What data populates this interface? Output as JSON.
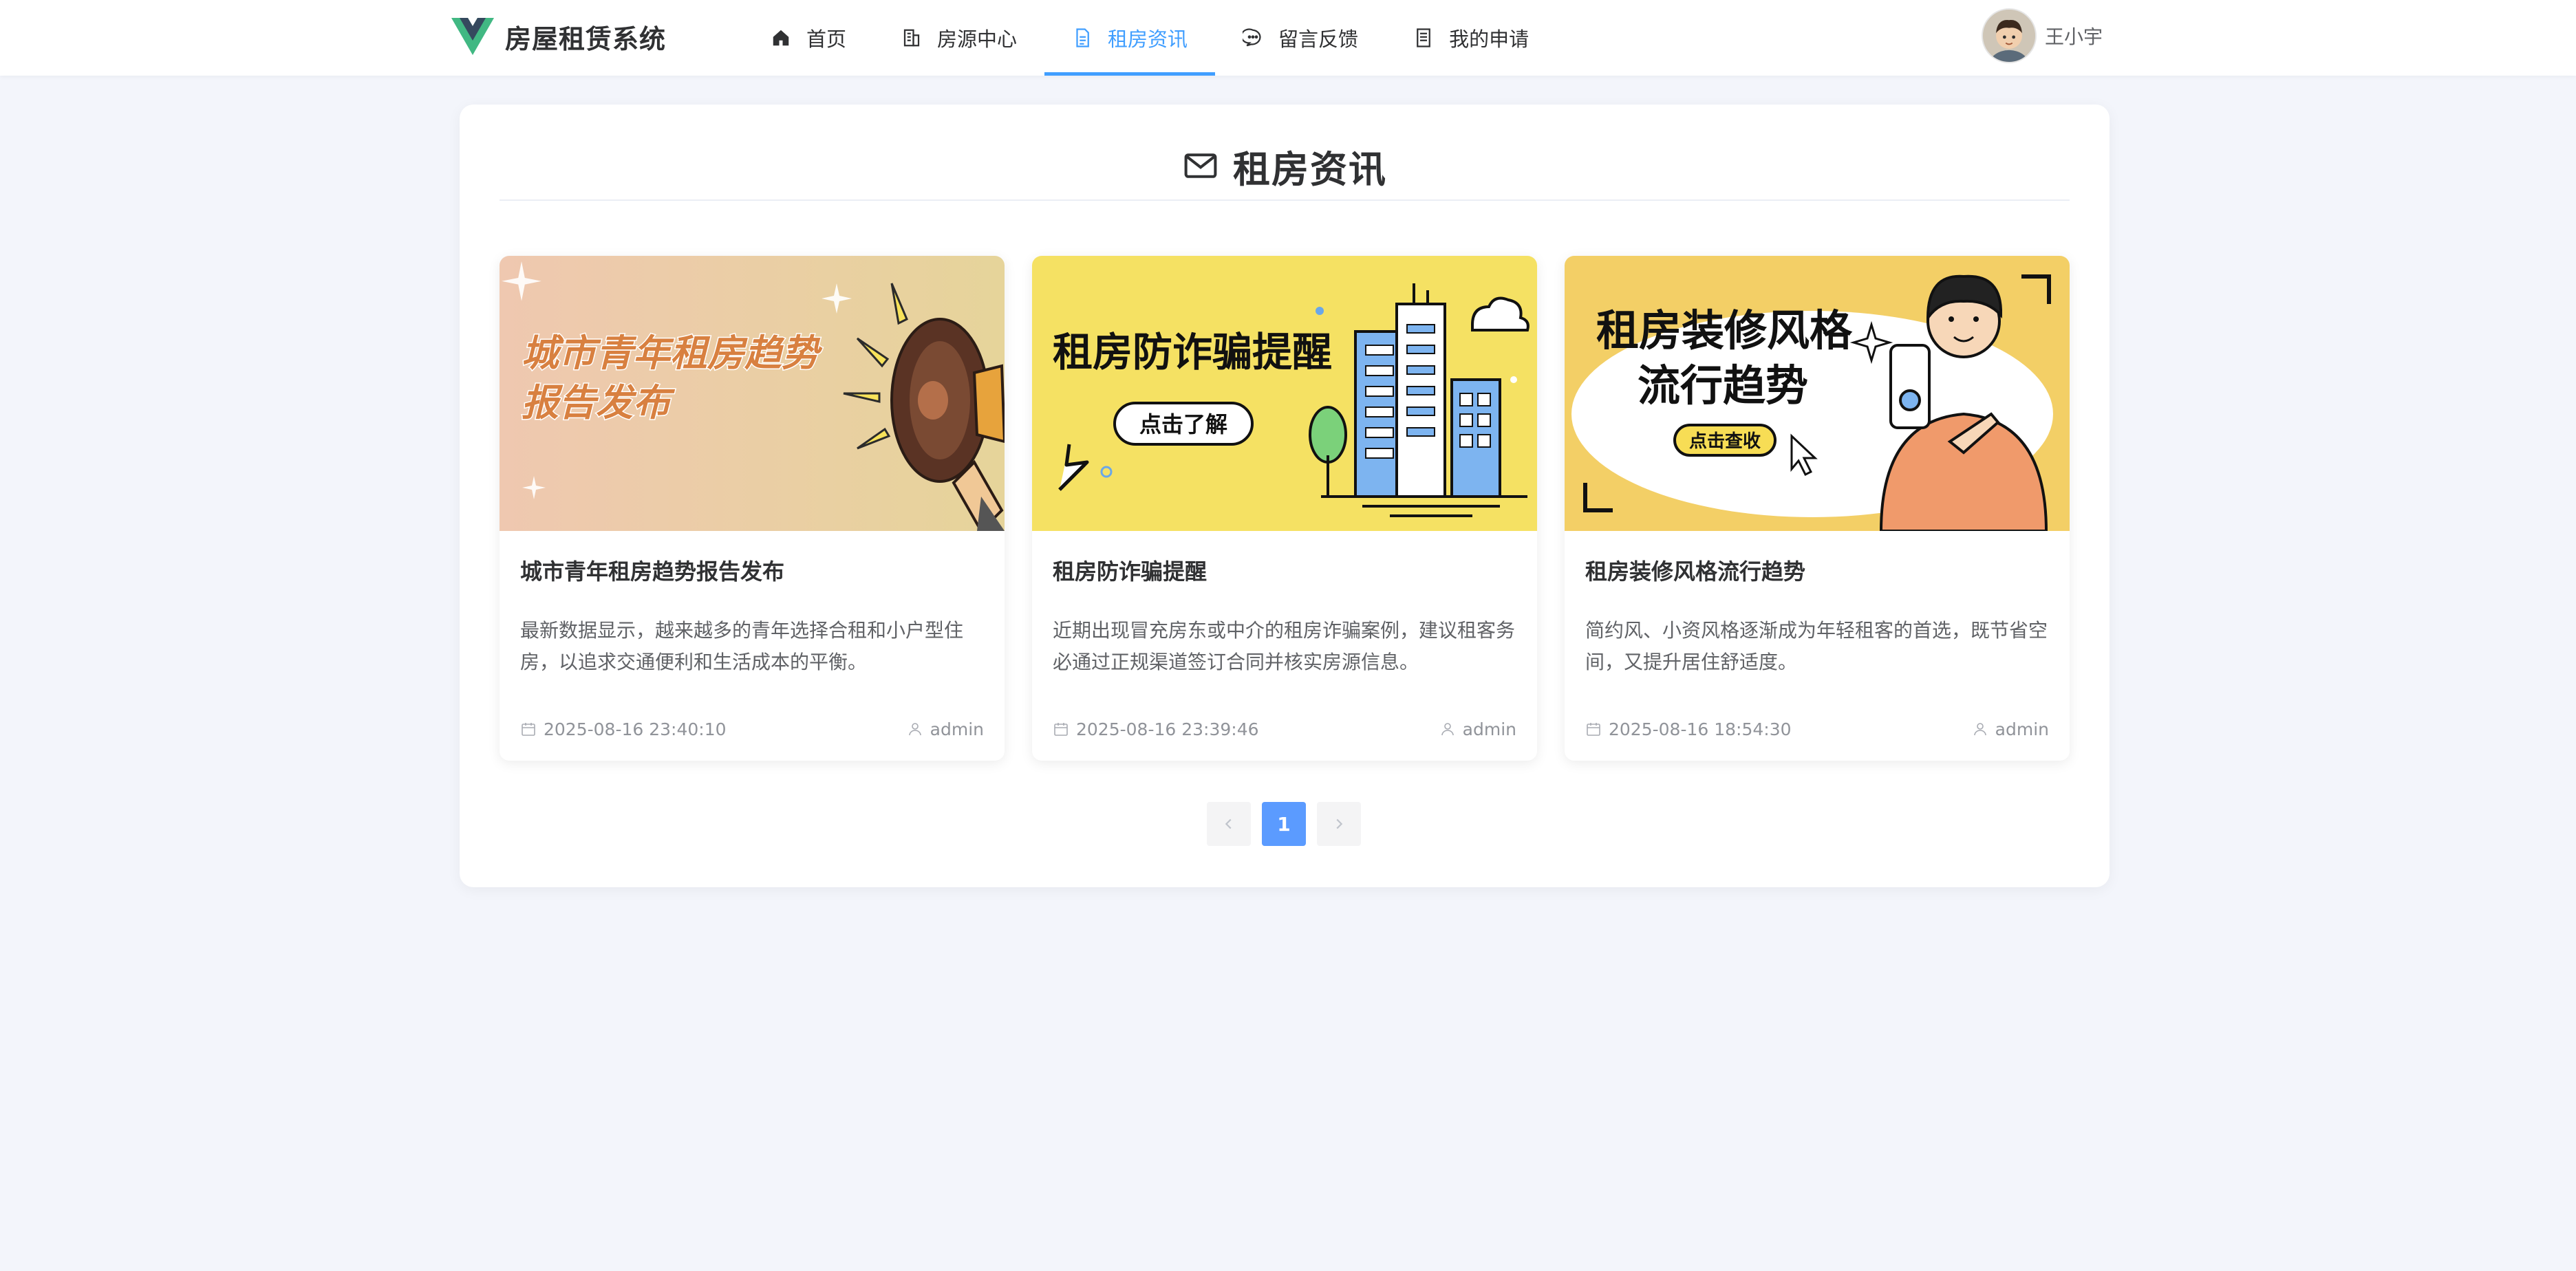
{
  "header": {
    "brand": "房屋租赁系统",
    "nav": [
      {
        "label": "首页",
        "icon": "home-icon"
      },
      {
        "label": "房源中心",
        "icon": "building-icon"
      },
      {
        "label": "租房资讯",
        "icon": "document-icon",
        "active": true
      },
      {
        "label": "留言反馈",
        "icon": "chat-icon"
      },
      {
        "label": "我的申请",
        "icon": "list-icon"
      }
    ],
    "user": {
      "name": "王小宇"
    }
  },
  "page": {
    "title": "租房资讯",
    "title_icon": "mail-icon"
  },
  "articles": [
    {
      "title": "城市青年租房趋势报告发布",
      "summary": "最新数据显示，越来越多的青年选择合租和小户型住房，以追求交通便利和生活成本的平衡。",
      "date": "2025-08-16 23:40:10",
      "author": "admin",
      "banner": {
        "headline_1": "城市青年租房趋势",
        "headline_2": "报告发布",
        "bg": "#efd9b8"
      }
    },
    {
      "title": "租房防诈骗提醒",
      "summary": "近期出现冒充房东或中介的租房诈骗案例，建议租客务必通过正规渠道签订合同并核实房源信息。",
      "date": "2025-08-16 23:39:46",
      "author": "admin",
      "banner": {
        "headline_1": "租房防诈骗提醒",
        "button": "点击了解",
        "bg": "#f5e163"
      }
    },
    {
      "title": "租房装修风格流行趋势",
      "summary": "简约风、小资风格逐渐成为年轻租客的首选，既节省空间，又提升居住舒适度。",
      "date": "2025-08-16 18:54:30",
      "author": "admin",
      "banner": {
        "headline_1": "租房装修风格",
        "headline_2": "流行趋势",
        "button": "点击查收",
        "bg": "#f3cf66"
      }
    }
  ],
  "pagination": {
    "current": "1"
  },
  "colors": {
    "accent": "#409eff",
    "page_bg": "#f3f5fb"
  }
}
